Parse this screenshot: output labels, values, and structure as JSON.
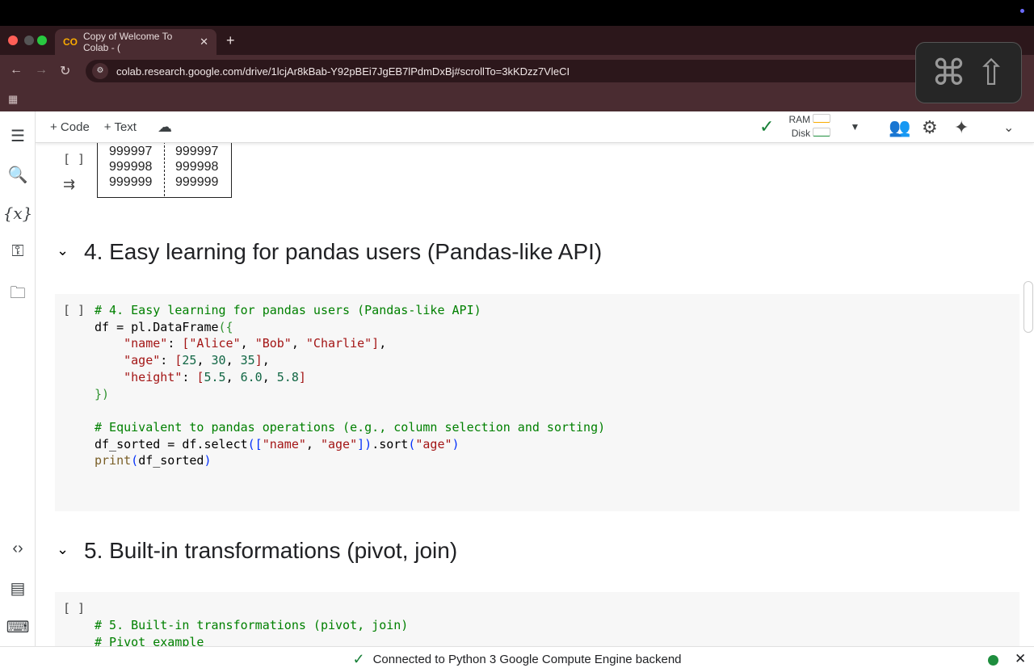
{
  "browser": {
    "tab_title": "Copy of Welcome To Colab - (",
    "tab_icon": "colab-logo",
    "url": "colab.research.google.com/drive/1lcjAr8kBab-Y92pBEi7JgEB7lPdmDxBj#scrollTo=3kKDzz7VleCI",
    "new_tab": "+"
  },
  "overlay": {
    "keys": "⌘ ⇧"
  },
  "toolbar": {
    "add_code": "+ Code",
    "add_text": "+ Text",
    "ram": "RAM",
    "disk": "Disk",
    "connected_check": "✓"
  },
  "output_table": {
    "col1": [
      "999997",
      "999998",
      "999999"
    ],
    "col2": [
      "999997",
      "999998",
      "999999"
    ]
  },
  "sections": [
    {
      "title": "4. Easy learning for pandas users (Pandas-like API)"
    },
    {
      "title": "5. Built-in transformations (pivot, join)"
    }
  ],
  "cell_bracket": "[ ]",
  "cell4_code": [
    [
      [
        "c",
        "# 4. Easy learning for pandas users (Pandas-like API)"
      ]
    ],
    [
      [
        "",
        "df = pl.DataFrame"
      ],
      [
        "g",
        "({"
      ]
    ],
    [
      [
        "",
        "    "
      ],
      [
        "s",
        "\"name\""
      ],
      [
        "",
        ": "
      ],
      [
        "s",
        "[\"Alice\""
      ],
      [
        "",
        ", "
      ],
      [
        "s",
        "\"Bob\""
      ],
      [
        "",
        ", "
      ],
      [
        "s",
        "\"Charlie\"]"
      ],
      [
        "",
        ","
      ]
    ],
    [
      [
        "",
        "    "
      ],
      [
        "s",
        "\"age\""
      ],
      [
        "",
        ": "
      ],
      [
        "s",
        "["
      ],
      [
        "n",
        "25"
      ],
      [
        "",
        ", "
      ],
      [
        "n",
        "30"
      ],
      [
        "",
        ", "
      ],
      [
        "n",
        "35"
      ],
      [
        "s",
        "]"
      ],
      [
        "",
        ","
      ]
    ],
    [
      [
        "",
        "    "
      ],
      [
        "s",
        "\"height\""
      ],
      [
        "",
        ": "
      ],
      [
        "s",
        "["
      ],
      [
        "n",
        "5.5"
      ],
      [
        "",
        ", "
      ],
      [
        "n",
        "6.0"
      ],
      [
        "",
        ", "
      ],
      [
        "n",
        "5.8"
      ],
      [
        "s",
        "]"
      ]
    ],
    [
      [
        "g",
        "})"
      ]
    ],
    [
      [
        "",
        ""
      ]
    ],
    [
      [
        "c",
        "# Equivalent to pandas operations (e.g., column selection and sorting)"
      ]
    ],
    [
      [
        "",
        "df_sorted = df.select"
      ],
      [
        "b",
        "(["
      ],
      [
        "s",
        "\"name\""
      ],
      [
        "",
        ", "
      ],
      [
        "s",
        "\"age\""
      ],
      [
        "b",
        "])"
      ],
      [
        "",
        ".sort"
      ],
      [
        "b",
        "("
      ],
      [
        "s",
        "\"age\""
      ],
      [
        "b",
        ")"
      ]
    ],
    [
      [
        "f",
        "print"
      ],
      [
        "b",
        "("
      ],
      [
        "",
        "df_sorted"
      ],
      [
        "b",
        ")"
      ]
    ]
  ],
  "cell5_code": [
    [
      [
        "c",
        "# 5. Built-in transformations (pivot, join)"
      ]
    ],
    [
      [
        "c",
        "# Pivot example"
      ]
    ]
  ],
  "status": {
    "text": "Connected to Python 3 Google Compute Engine backend",
    "indicator_color": "#1e8e3e"
  },
  "colors": {
    "chrome": "#4a2c31",
    "accent_check": "#188038"
  }
}
